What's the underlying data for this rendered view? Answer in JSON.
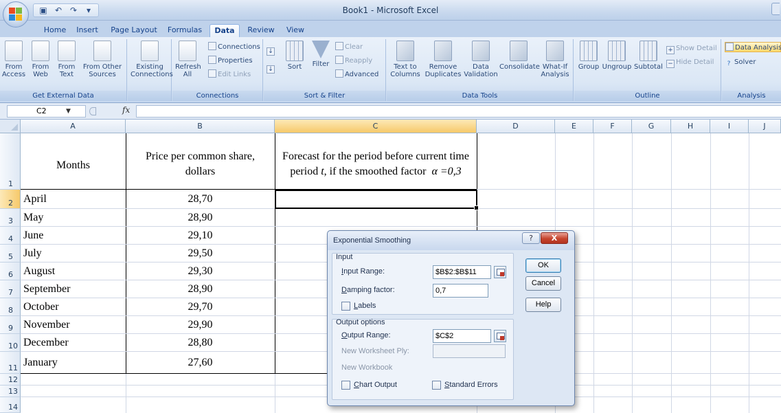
{
  "window": {
    "title": "Book1 - Microsoft Excel"
  },
  "tabs": [
    {
      "label": "Home"
    },
    {
      "label": "Insert"
    },
    {
      "label": "Page Layout"
    },
    {
      "label": "Formulas"
    },
    {
      "label": "Data",
      "active": true
    },
    {
      "label": "Review"
    },
    {
      "label": "View"
    }
  ],
  "ribbon": {
    "get_external_data": {
      "label": "Get External Data",
      "buttons": [
        "From Access",
        "From Web",
        "From Text",
        "From Other Sources"
      ]
    },
    "existing_connections": "Existing Connections",
    "connections": {
      "label": "Connections",
      "refresh": "Refresh All",
      "connections": "Connections",
      "properties": "Properties",
      "edit_links": "Edit Links"
    },
    "sort_filter": {
      "label": "Sort & Filter",
      "sort": "Sort",
      "filter": "Filter",
      "clear": "Clear",
      "reapply": "Reapply",
      "advanced": "Advanced"
    },
    "data_tools": {
      "label": "Data Tools",
      "text_to_columns": "Text to Columns",
      "remove_duplicates": "Remove Duplicates",
      "data_validation": "Data Validation",
      "consolidate": "Consolidate",
      "what_if": "What-If Analysis"
    },
    "outline": {
      "label": "Outline",
      "group": "Group",
      "ungroup": "Ungroup",
      "subtotal": "Subtotal",
      "show_detail": "Show Detail",
      "hide_detail": "Hide Detail"
    },
    "analysis": {
      "label": "Analysis",
      "data_analysis": "Data Analysis",
      "solver": "Solver"
    }
  },
  "formula_bar": {
    "name_box": "C2",
    "fx": "fx",
    "value": ""
  },
  "sheet": {
    "columns": [
      "A",
      "B",
      "C",
      "D",
      "E",
      "F",
      "G",
      "H",
      "I",
      "J"
    ],
    "rows": [
      "1",
      "2",
      "3",
      "4",
      "5",
      "6",
      "7",
      "8",
      "9",
      "10",
      "11",
      "12",
      "13",
      "14"
    ],
    "selected_cell": "C2",
    "header_a": "Months",
    "header_b_line1": "Price per common share,",
    "header_b_line2": "dollars",
    "header_c_line1": "Forecast for the period before current time",
    "header_c_line2_a": "period",
    "header_c_line2_t": "t",
    "header_c_line2_b": ", if the smoothed factor",
    "header_c_line2_alpha": "α =0,3",
    "data": [
      {
        "month": "April",
        "price": "28,70"
      },
      {
        "month": "May",
        "price": "28,90"
      },
      {
        "month": "June",
        "price": "29,10"
      },
      {
        "month": "July",
        "price": "29,50"
      },
      {
        "month": "August",
        "price": "29,30"
      },
      {
        "month": "September",
        "price": "28,90"
      },
      {
        "month": "October",
        "price": "29,70"
      },
      {
        "month": "November",
        "price": "29,90"
      },
      {
        "month": "December",
        "price": "28,80"
      },
      {
        "month": "January",
        "price": "27,60"
      }
    ]
  },
  "dialog": {
    "title": "Exponential Smoothing",
    "help_glyph": "?",
    "close_glyph": "X",
    "input_section": "Input",
    "input_range_label": "Input Range:",
    "input_range_value": "$B$2:$B$11",
    "damping_label": "Damping factor:",
    "damping_value": "0,7",
    "labels_label": "Labels",
    "output_section": "Output options",
    "output_range_label": "Output Range:",
    "output_range_value": "$C$2",
    "new_ply_label": "New Worksheet Ply:",
    "new_workbook_label": "New Workbook",
    "chart_output_label": "Chart Output",
    "standard_errors_label": "Standard Errors",
    "ok": "OK",
    "cancel": "Cancel",
    "help": "Help"
  }
}
